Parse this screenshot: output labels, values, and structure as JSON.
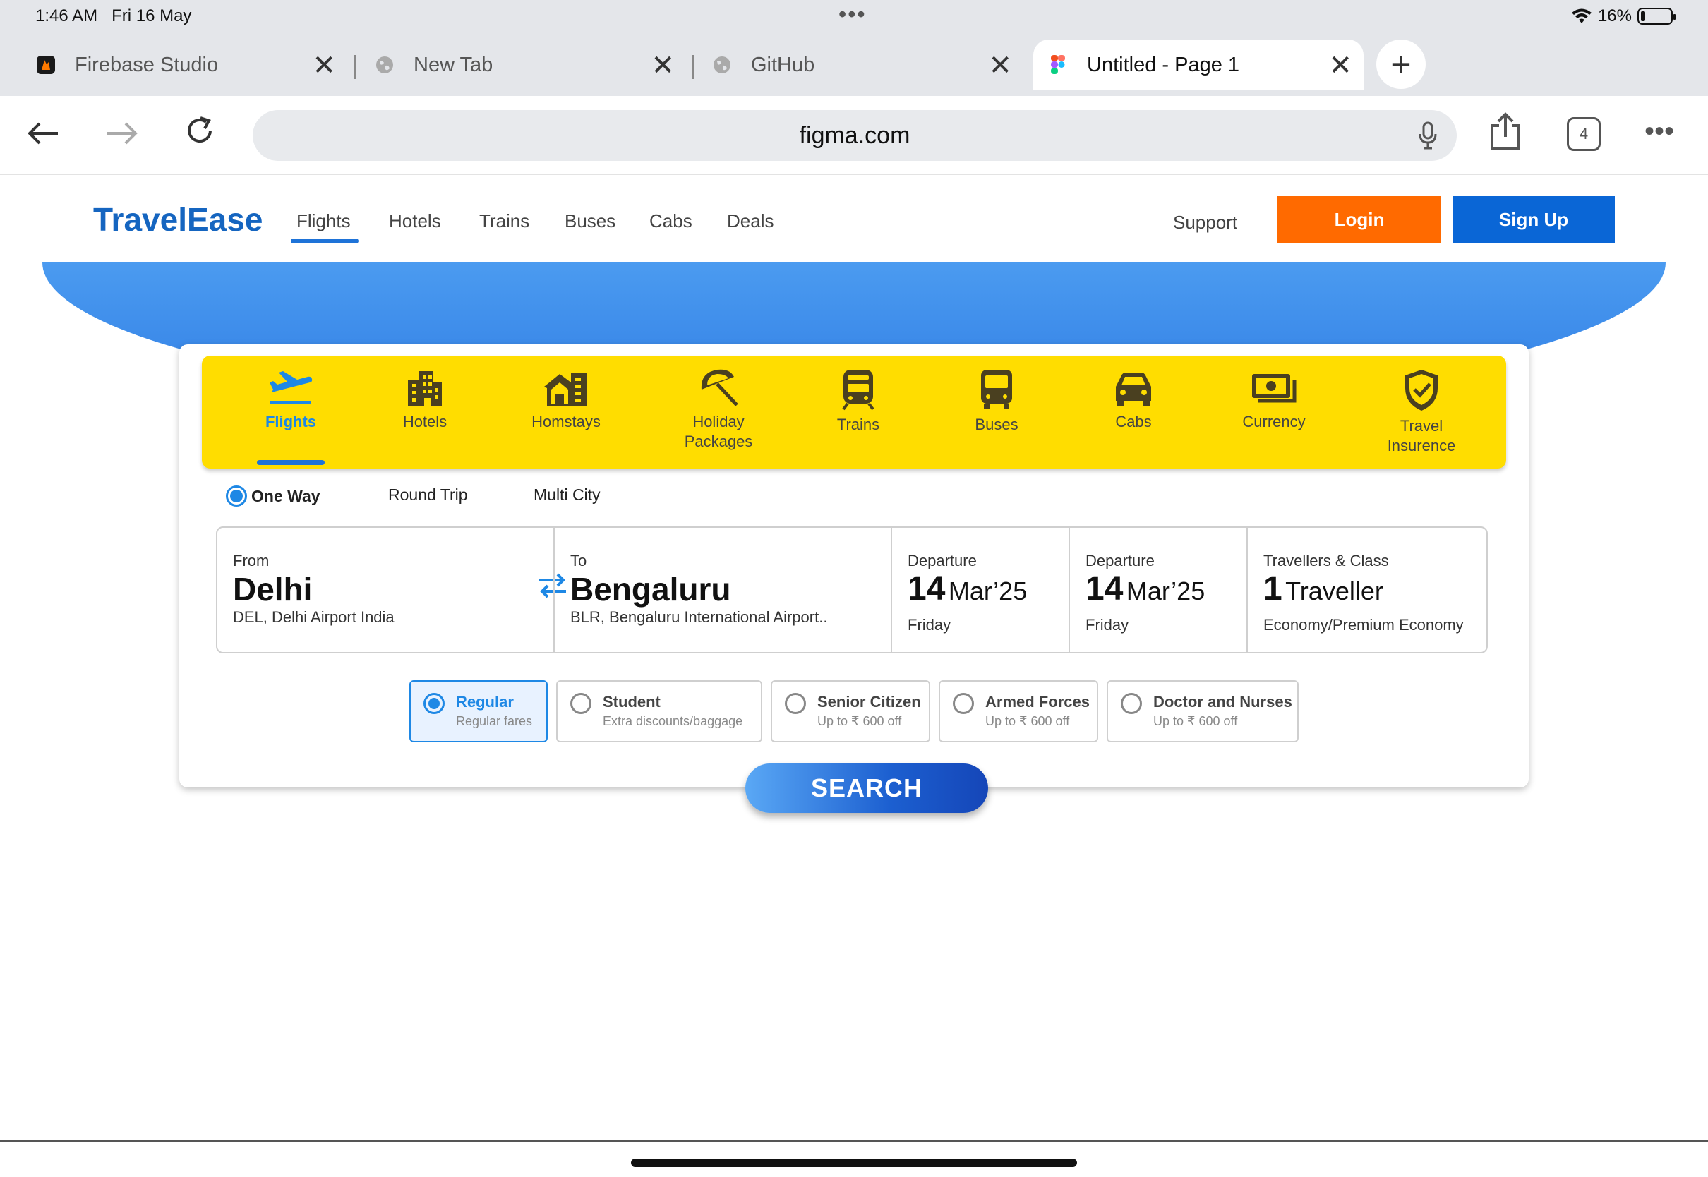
{
  "status": {
    "time": "1:46 AM",
    "date": "Fri 16 May",
    "battery": "16%",
    "battery_level": 0.16
  },
  "tabs": [
    {
      "title": "Firebase Studio",
      "icon": "firebase-icon"
    },
    {
      "title": "New Tab",
      "icon": "globe-icon"
    },
    {
      "title": "GitHub",
      "icon": "globe-icon"
    },
    {
      "title": "Untitled - Page 1",
      "icon": "figma-icon"
    }
  ],
  "toolbar": {
    "url": "figma.com",
    "tab_count": "4"
  },
  "site": {
    "brand": "TravelEase",
    "nav": [
      "Flights",
      "Hotels",
      "Trains",
      "Buses",
      "Cabs",
      "Deals"
    ],
    "support": "Support",
    "login": "Login",
    "signup": "Sign Up"
  },
  "categories": [
    {
      "label": "Flights",
      "icon": "airplane-takeoff-icon"
    },
    {
      "label": "Hotels",
      "icon": "building-icon"
    },
    {
      "label": "Homstays",
      "icon": "house-icon"
    },
    {
      "label": "Holiday\nPackages",
      "icon": "beach-umbrella-icon"
    },
    {
      "label": "Trains",
      "icon": "train-icon"
    },
    {
      "label": "Buses",
      "icon": "bus-icon"
    },
    {
      "label": "Cabs",
      "icon": "car-icon"
    },
    {
      "label": "Currency",
      "icon": "money-icon"
    },
    {
      "label": "Travel\nInsurence",
      "icon": "shield-check-icon"
    }
  ],
  "trip_types": [
    "One Way",
    "Round Trip",
    "Multi City"
  ],
  "from": {
    "label": "From",
    "city": "Delhi",
    "airport": "DEL, Delhi Airport India"
  },
  "to": {
    "label": "To",
    "city": "Bengaluru",
    "airport": "BLR, Bengaluru International Airport.."
  },
  "departure1": {
    "label": "Departure",
    "day": "14",
    "month": "Mar’25",
    "weekday": "Friday"
  },
  "departure2": {
    "label": "Departure",
    "day": "14",
    "month": "Mar’25",
    "weekday": "Friday"
  },
  "travellers": {
    "label": "Travellers & Class",
    "count": "1",
    "unit": "Traveller",
    "class": "Economy/Premium Economy"
  },
  "fares": [
    {
      "title": "Regular",
      "sub": "Regular fares"
    },
    {
      "title": "Student",
      "sub": "Extra discounts/baggage"
    },
    {
      "title": "Senior Citizen",
      "sub": "Up to ₹ 600 off"
    },
    {
      "title": "Armed Forces",
      "sub": "Up to ₹ 600 off"
    },
    {
      "title": "Doctor and Nurses",
      "sub": "Up to ₹ 600 off"
    }
  ],
  "search_label": "SEARCH",
  "colors": {
    "brand_blue": "#1565c0",
    "login_orange": "#ff6a00",
    "signup_blue": "#0a66d6",
    "category_yellow": "#ffdd00"
  }
}
